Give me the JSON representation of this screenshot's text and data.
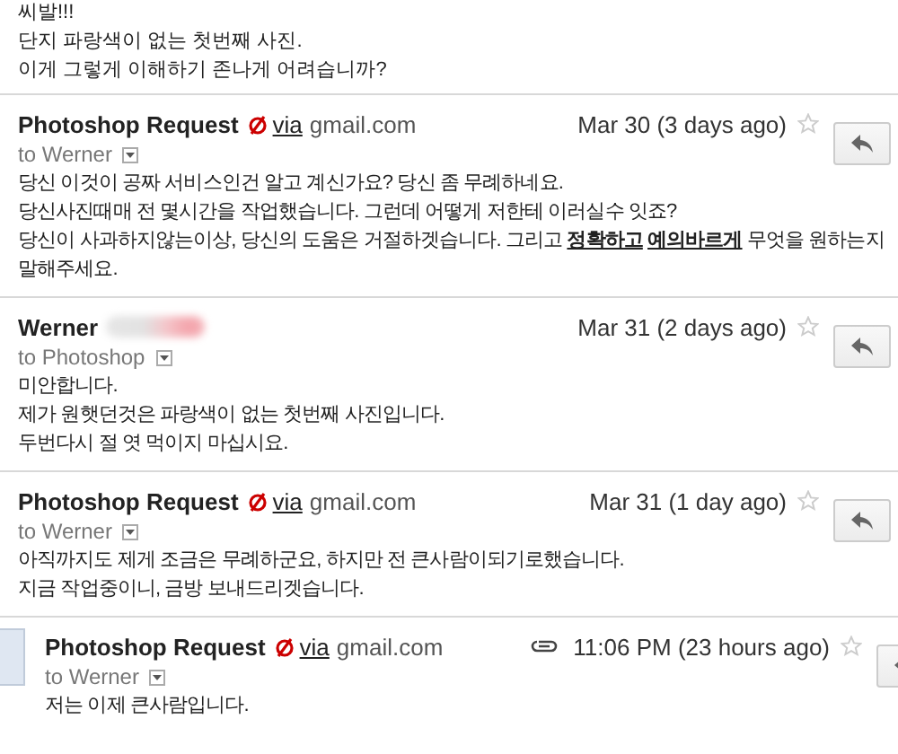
{
  "intro": {
    "lines": [
      "씨발!!!",
      "단지 파랑색이 없는 첫번째 사진.",
      "이게 그렇게 이해하기 존나게 어려습니까?"
    ]
  },
  "messages": [
    {
      "sender": "Photoshop Request",
      "redacted": false,
      "via": "via",
      "domain": "gmail.com",
      "date": "Mar 30 (3 days ago)",
      "starred": false,
      "attachment": false,
      "avatar": false,
      "recipient": "to Werner",
      "body": [
        "당신 이것이 공짜 서비스인건 알고 계신가요? 당신 좀 무례하네요.",
        "당신사진때매 전 몇시간을 작업했습니다. 그런데 어떻게 저한테 이러실수 잇죠?",
        "당신이 사과하지않는이상, 당신의 도움은 거절하겟습니다. 그리고 **정확하고** **예의바르게** 무엇을 원하는지",
        "말해주세요."
      ]
    },
    {
      "sender": "Werner",
      "redacted": true,
      "date": "Mar 31 (2 days ago)",
      "starred": false,
      "attachment": false,
      "avatar": false,
      "recipient": "to Photoshop",
      "body": [
        "미안합니다.",
        "제가 원햇던것은 파랑색이 없는 첫번째 사진입니다.",
        "두번다시 절 엿 먹이지 마십시요."
      ]
    },
    {
      "sender": "Photoshop Request",
      "redacted": false,
      "via": "via",
      "domain": "gmail.com",
      "date": "Mar 31 (1 day ago)",
      "starred": false,
      "attachment": false,
      "avatar": false,
      "recipient": "to Werner",
      "body": [
        "아직까지도 제게 조금은 무례하군요, 하지만 전 큰사람이되기로했습니다.",
        "지금 작업중이니, 금방 보내드리겟습니다."
      ]
    },
    {
      "sender": "Photoshop Request",
      "redacted": false,
      "via": "via",
      "domain": "gmail.com",
      "date": "11:06 PM (23 hours ago)",
      "starred": false,
      "attachment": true,
      "avatar": true,
      "recipient": "to Werner",
      "body": [
        "저는 이제 큰사람입니다."
      ]
    }
  ]
}
